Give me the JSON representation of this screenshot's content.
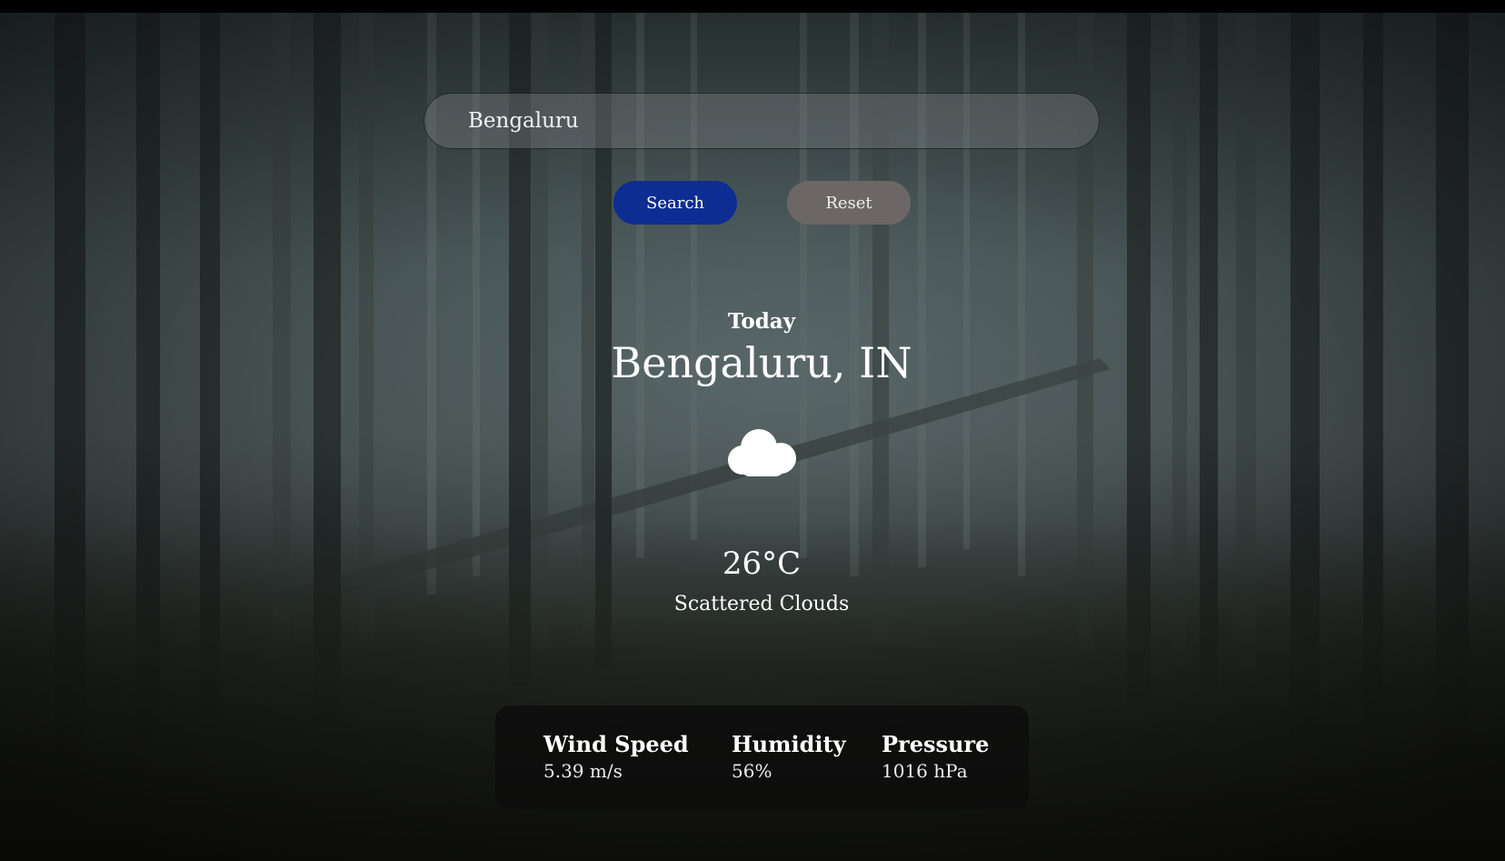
{
  "search": {
    "value": "Bengaluru",
    "search_label": "Search",
    "reset_label": "Reset"
  },
  "weather": {
    "day_label": "Today",
    "location": "Bengaluru, IN",
    "icon": "cloud-icon",
    "temperature": "26°C",
    "description": "Scattered Clouds"
  },
  "stats": [
    {
      "label": "Wind Speed",
      "value": "5.39 m/s"
    },
    {
      "label": "Humidity",
      "value": "56%"
    },
    {
      "label": "Pressure",
      "value": "1016 hPa"
    }
  ],
  "colors": {
    "search_button": "#0d2d93",
    "reset_button": "#6c6766",
    "panel": "#0c0c0c"
  }
}
